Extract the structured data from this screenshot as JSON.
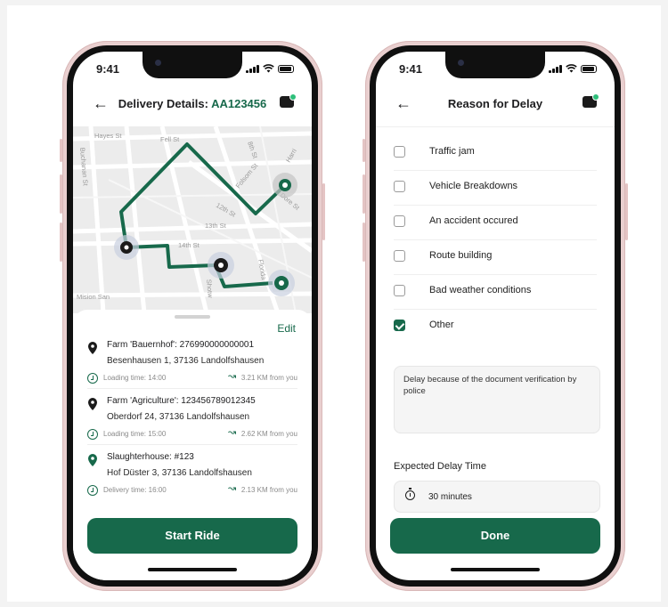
{
  "status": {
    "time": "9:41"
  },
  "delivery": {
    "header": {
      "title_prefix": "Delivery Details:",
      "order_code": "AA123456"
    },
    "map": {
      "streets": [
        "Hayes St",
        "Fell St",
        "8th St",
        "Harri",
        "Buchanan St",
        "Folsom St",
        "12th St",
        "13th St",
        "14th St",
        "Dore St",
        "Mision San",
        "Shotw",
        "Florida"
      ]
    },
    "edit_label": "Edit",
    "stops": [
      {
        "name": "Farm 'Bauernhof': 276990000000001",
        "address": "Besenhausen 1, 37136 Landolfshausen",
        "time": "Loading time: 14:00",
        "distance": "3.21 KM from you",
        "pin": "pin-icon"
      },
      {
        "name": "Farm 'Agriculture': 123456789012345",
        "address": "Oberdorf 24, 37136 Landolfshausen",
        "time": "Loading time: 15:00",
        "distance": "2.62 KM from you",
        "pin": "pin-icon"
      },
      {
        "name": "Slaughterhouse: #123",
        "address": "Hof Düster 3, 37136 Landolfshausen",
        "time": "Delivery time: 16:00",
        "distance": "2.13 KM from you",
        "pin": "pin-icon-green"
      }
    ],
    "cta_label": "Start Ride"
  },
  "delay": {
    "header": {
      "title": "Reason for Delay"
    },
    "reasons": [
      {
        "label": "Traffic jam",
        "checked": false
      },
      {
        "label": "Vehicle Breakdowns",
        "checked": false
      },
      {
        "label": "An accident occured",
        "checked": false
      },
      {
        "label": "Route building",
        "checked": false
      },
      {
        "label": "Bad weather conditions",
        "checked": false
      },
      {
        "label": "Other",
        "checked": true
      }
    ],
    "comment": "Delay because of the document verification by police",
    "delay_label": "Expected Delay Time",
    "delay_value": "30 minutes",
    "cta_label": "Done"
  },
  "colors": {
    "accent": "#17694b",
    "frame": "#e9cfcf",
    "map_bg": "#ececec"
  }
}
